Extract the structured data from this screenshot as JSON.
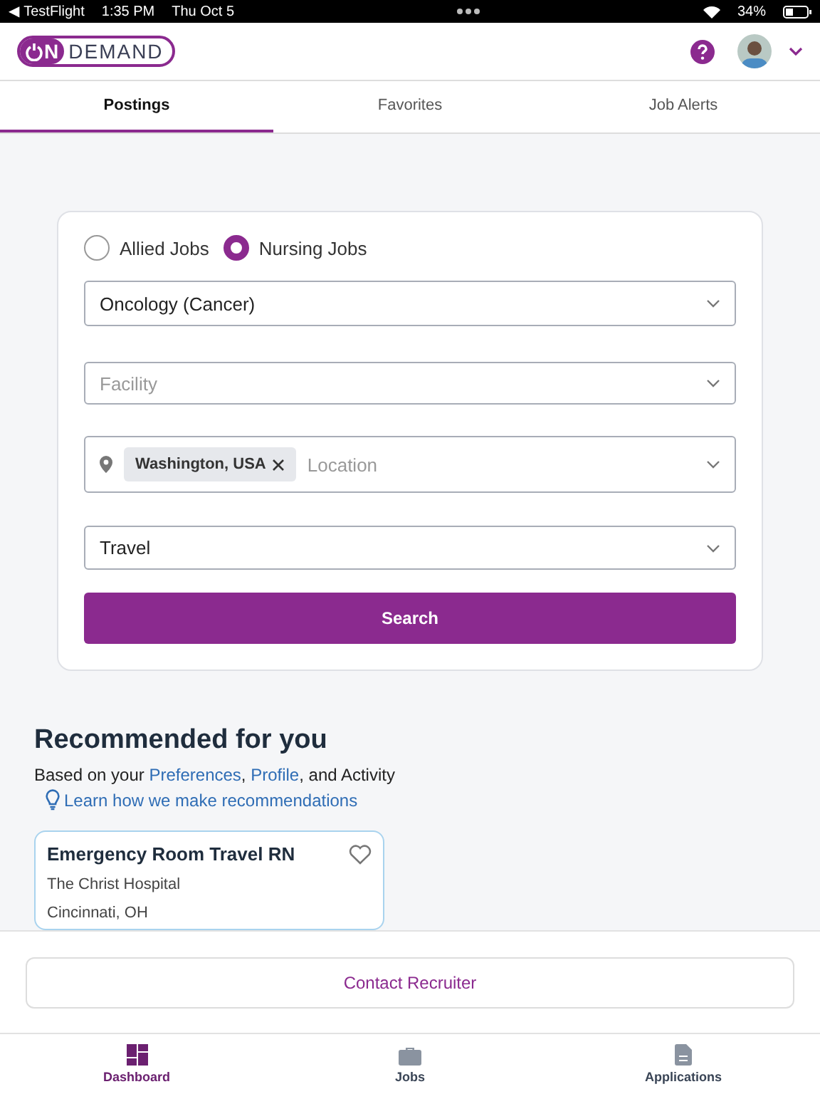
{
  "status_bar": {
    "back": "◀ TestFlight",
    "time": "1:35 PM",
    "date": "Thu Oct 5",
    "battery": "34%"
  },
  "header": {
    "logo": {
      "letter": "N",
      "word": "DEMAND"
    }
  },
  "tabs": [
    {
      "label": "Postings",
      "selected": true
    },
    {
      "label": "Favorites",
      "selected": false
    },
    {
      "label": "Job Alerts",
      "selected": false
    }
  ],
  "search_form": {
    "job_types": [
      {
        "label": "Allied Jobs",
        "selected": false
      },
      {
        "label": "Nursing Jobs",
        "selected": true
      }
    ],
    "specialty": {
      "value": "Oncology (Cancer)"
    },
    "facility": {
      "placeholder": "Facility"
    },
    "location": {
      "chips": [
        "Washington, USA"
      ],
      "placeholder": "Location"
    },
    "job_type": {
      "value": "Travel"
    },
    "button": "Search"
  },
  "recommended": {
    "title": "Recommended for you",
    "subtitle": {
      "lead": "Based on your ",
      "links": [
        {
          "text": "Preferences",
          "after": ", "
        },
        {
          "text": "Profile",
          "after": ", and Activity"
        }
      ]
    },
    "learn_link": "Learn how we make recommendations",
    "jobs": [
      {
        "title": "Emergency Room Travel RN",
        "facility": "The Christ Hospital",
        "location": "Cincinnati, OH",
        "favorite": false
      }
    ]
  },
  "contact_button": "Contact Recruiter",
  "bottom_nav": [
    {
      "label": "Dashboard",
      "kind": "dashboard",
      "selected": true
    },
    {
      "label": "Jobs",
      "kind": "jobs",
      "selected": false
    },
    {
      "label": "Applications",
      "kind": "applications",
      "selected": false
    }
  ]
}
